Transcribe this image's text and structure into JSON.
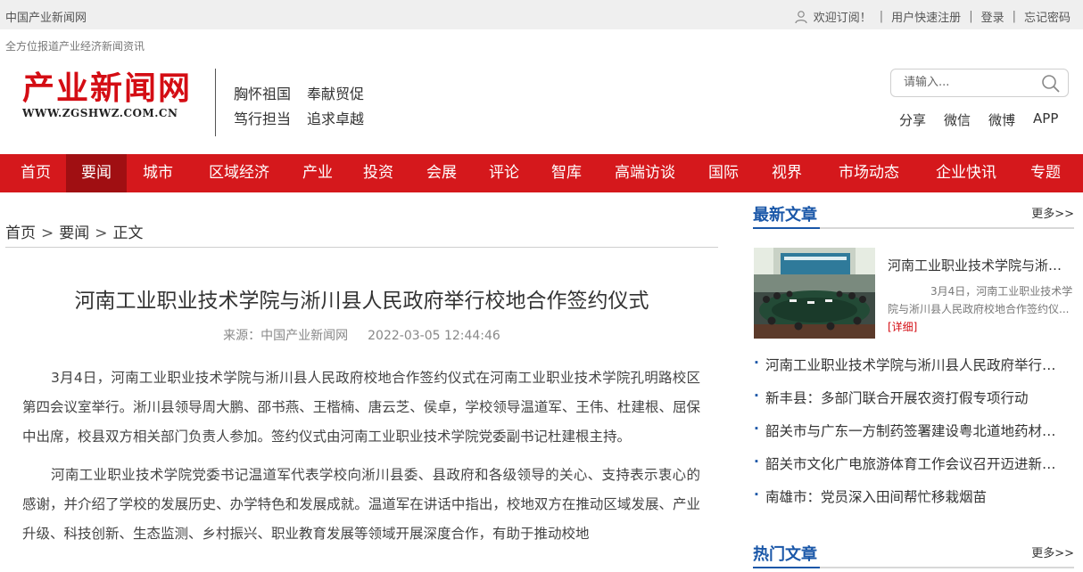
{
  "topbar": {
    "site_name": "中国产业新闻网",
    "welcome": "欢迎订阅！",
    "register": "用户快速注册",
    "login": "登录",
    "forgot": "忘记密码",
    "sep": "|"
  },
  "slogan": "全方位报道产业经济新闻资讯",
  "logo": {
    "cn": "产业新闻网",
    "url": "WWW.ZGSHWZ.COM.CN",
    "color": "#d40d14"
  },
  "mottos": [
    [
      "胸怀祖国",
      "奉献贸促"
    ],
    [
      "笃行担当",
      "追求卓越"
    ]
  ],
  "search": {
    "placeholder": "请输入..."
  },
  "share": [
    "分享",
    "微信",
    "微博",
    "APP"
  ],
  "nav": {
    "color": "#d5181c",
    "active_color": "#a00f12",
    "items": [
      "首页",
      "要闻",
      "城市",
      "区域经济",
      "产业",
      "投资",
      "会展",
      "评论",
      "智库",
      "高端访谈",
      "国际",
      "视界",
      "市场动态",
      "企业快讯",
      "专题"
    ],
    "active": "要闻"
  },
  "breadcrumb": {
    "home": "首页",
    "section": "要闻",
    "current": "正文",
    "sep": ">"
  },
  "article": {
    "title": "河南工业职业技术学院与淅川县人民政府举行校地合作签约仪式",
    "source": "来源：中国产业新闻网",
    "date": "2022-03-05 12:44:46",
    "paragraphs": [
      "3月4日，河南工业职业技术学院与淅川县人民政府校地合作签约仪式在河南工业职业技术学院孔明路校区第四会议室举行。淅川县领导周大鹏、邵书燕、王楷楠、唐云芝、侯卓，学校领导温道军、王伟、杜建根、屈保中出席，校县双方相关部门负责人参加。签约仪式由河南工业职业技术学院党委副书记杜建根主持。",
      "河南工业职业技术学院党委书记温道军代表学校向淅川县委、县政府和各级领导的关心、支持表示衷心的感谢，并介绍了学校的发展历史、办学特色和发展成就。温道军在讲话中指出，校地双方在推动区域发展、产业升级、科技创新、生态监测、乡村振兴、职业教育发展等领域开展深度合作，有助于推动校地"
    ]
  },
  "sidebar": {
    "accent": "#1a57a8",
    "latest": {
      "heading": "最新文章",
      "more": "更多>>",
      "featured_title": "河南工业职业技术学院与淅川县人民政府举行校地合作签约仪式",
      "featured_summary": "3月4日，河南工业职业技术学院与淅川县人民政府校地合作签约仪...",
      "featured_more": "[详细]",
      "list": [
        "河南工业职业技术学院与淅川县人民政府举行校地合作签约仪式",
        "新丰县：多部门联合开展农资打假专项行动",
        "韶关市与广东一方制药签署建设粤北道地药材产业基地合作协议",
        "韶关市文化广电旅游体育工作会议召开迈进新征程",
        "南雄市：党员深入田间帮忙移栽烟苗"
      ]
    },
    "hot": {
      "heading": "热门文章",
      "more": "更多>>"
    }
  }
}
